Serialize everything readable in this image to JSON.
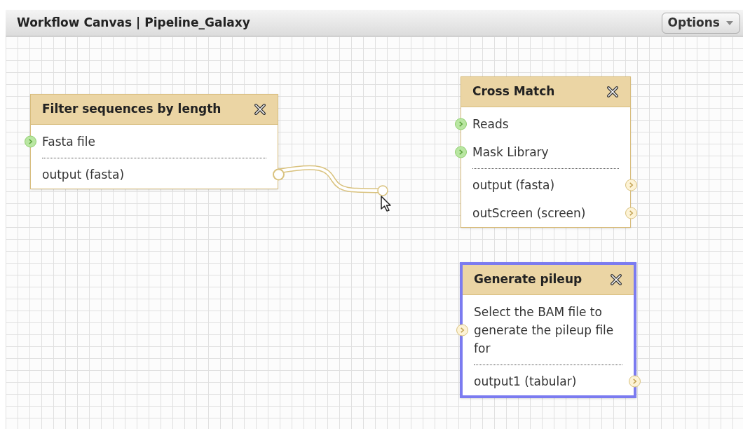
{
  "header": {
    "title": "Workflow Canvas | Pipeline_Galaxy",
    "options_button": "Options"
  },
  "nodes": [
    {
      "title": "Filter sequences by length",
      "selected": false,
      "inputs": [
        {
          "label": "Fasta file",
          "highlighted": true
        }
      ],
      "outputs": [
        {
          "label": "output (fasta)",
          "connected": true
        }
      ]
    },
    {
      "title": "Cross Match",
      "selected": false,
      "inputs": [
        {
          "label": "Reads",
          "highlighted": true
        },
        {
          "label": "Mask Library",
          "highlighted": true
        }
      ],
      "outputs": [
        {
          "label": "output (fasta)",
          "connected": false
        },
        {
          "label": "outScreen (screen)",
          "connected": false
        }
      ]
    },
    {
      "title": "Generate pileup",
      "selected": true,
      "inputs": [
        {
          "label": "Select the BAM file to generate the pileup file for",
          "highlighted": false
        }
      ],
      "outputs": [
        {
          "label": "output1 (tabular)",
          "connected": false
        }
      ]
    }
  ]
}
